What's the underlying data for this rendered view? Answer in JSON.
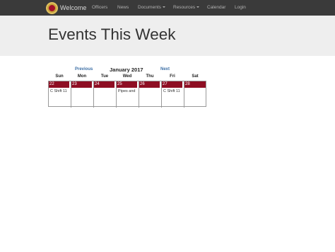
{
  "nav": {
    "brand": "Welcome",
    "items": [
      "Officers",
      "News",
      "Documents",
      "Resources",
      "Calendar",
      "Login"
    ]
  },
  "page": {
    "title": "Events This Week"
  },
  "calendar": {
    "prev": "Previous",
    "next": "Next",
    "month": "January 2017",
    "weekdays": [
      "Sun",
      "Mon",
      "Tue",
      "Wed",
      "Thu",
      "Fri",
      "Sat"
    ],
    "days": [
      {
        "num": "22",
        "event": "C Shift 11"
      },
      {
        "num": "23",
        "event": ""
      },
      {
        "num": "24",
        "event": ""
      },
      {
        "num": "25",
        "event": "Pipes and"
      },
      {
        "num": "26",
        "event": ""
      },
      {
        "num": "27",
        "event": "C Shift 11"
      },
      {
        "num": "28",
        "event": ""
      }
    ]
  },
  "colors": {
    "navbar": "#3a3a3a",
    "dayHeader": "#8e0e23",
    "link": "#3b6ea5"
  }
}
